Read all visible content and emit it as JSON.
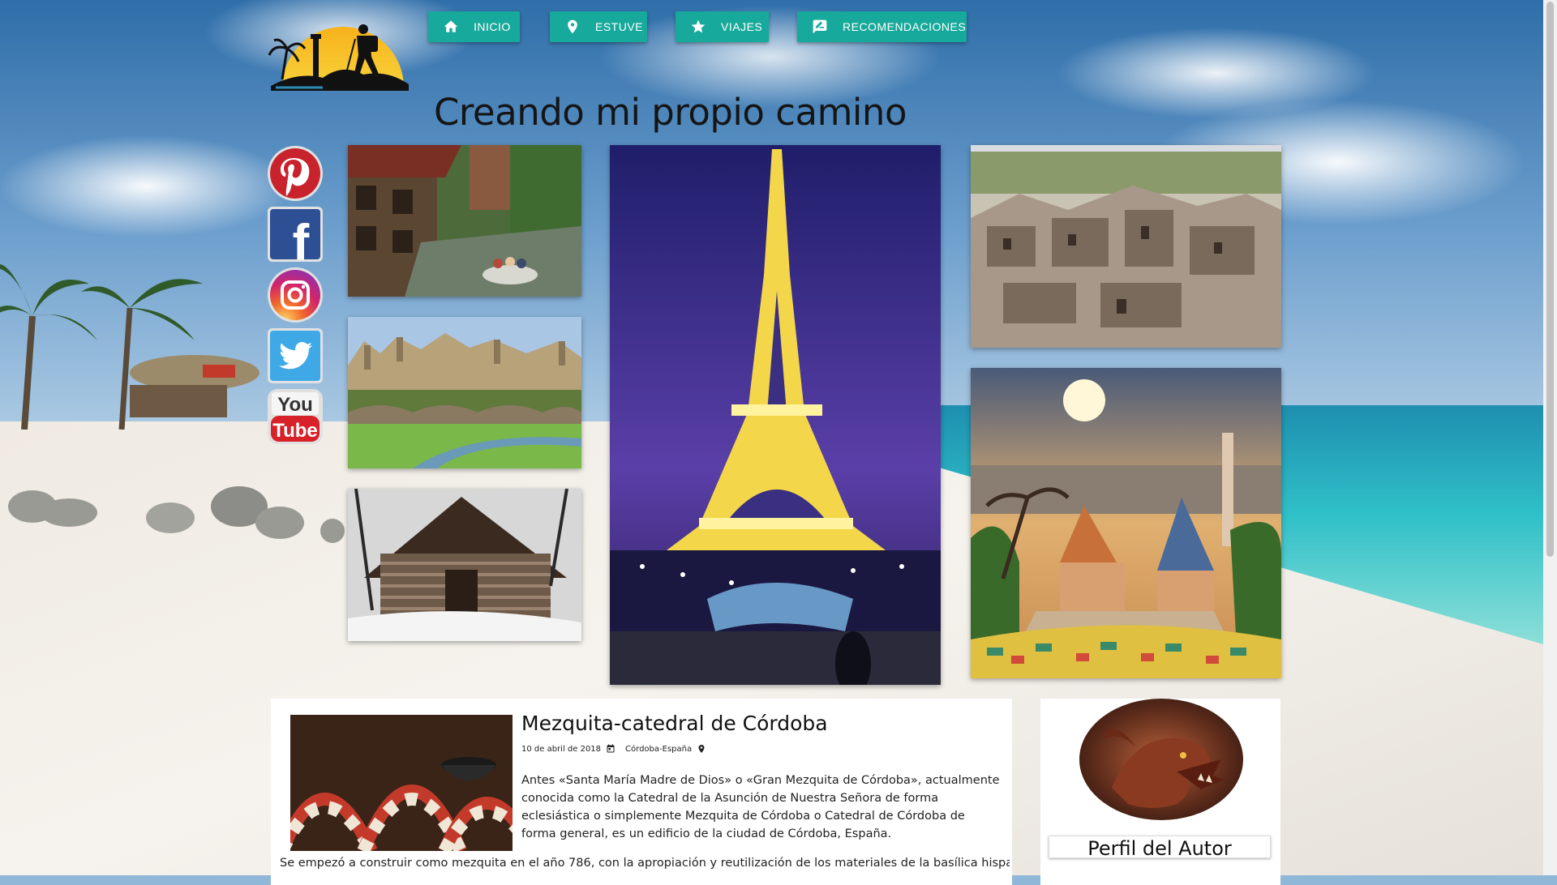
{
  "site": {
    "title": "Creando mi propio camino"
  },
  "nav": [
    {
      "label": "INICIO",
      "icon": "home-icon"
    },
    {
      "label": "ESTUVE",
      "icon": "map-pin-icon"
    },
    {
      "label": "VIAJES",
      "icon": "star-icon"
    },
    {
      "label": "RECOMENDACIONES",
      "icon": "comment-edit-icon"
    }
  ],
  "social": [
    "pinterest-icon",
    "facebook-icon",
    "instagram-icon",
    "twitter-icon",
    "youtube-icon"
  ],
  "social_text": {
    "facebook": "f",
    "youtube_top": "You",
    "youtube_bottom": "Tube"
  },
  "article": {
    "title": "Mezquita-catedral de Córdoba",
    "date": "10 de abril de 2018",
    "location": "Córdoba-España",
    "paragraph1": "Antes «Santa María Madre de Dios» o «Gran Mezquita de Córdoba», actualmente conocida como la Catedral de la Asunción de Nuestra Señora de forma eclesiástica o simplemente Mezquita de Córdoba o Catedral de Córdoba de forma general, es un edificio de la ciudad de Córdoba, España.",
    "paragraph2": "Se empezó a construir como mezquita en el año 786, con la apropiación y reutilización de los materiales de la basílica hispanorromana"
  },
  "author": {
    "label": "Perfil del Autor"
  },
  "colors": {
    "nav": "#17a99b",
    "title": "#151515"
  }
}
